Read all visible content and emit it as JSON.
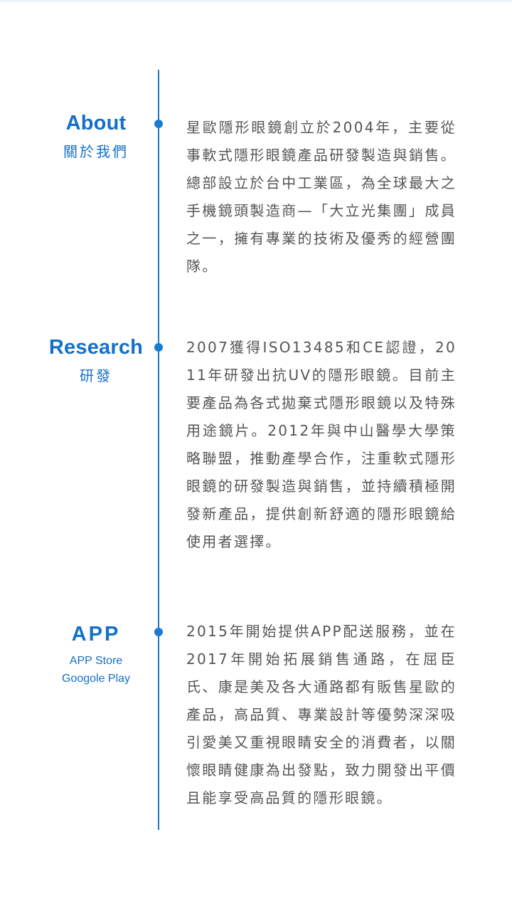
{
  "sections": [
    {
      "title": "About",
      "subtitle": "關於我們",
      "body": "星歐隱形眼鏡創立於2004年，主要從事軟式隱形眼鏡產品研發製造與銷售。總部設立於台中工業區，為全球最大之手機鏡頭製造商—「大立光集團」成員之一，擁有專業的技術及優秀的經營團隊。"
    },
    {
      "title": "Research",
      "subtitle": "研發",
      "body": "2007獲得ISO13485和CE認證，2011年研發出抗UV的隱形眼鏡。目前主要產品為各式拋棄式隱形眼鏡以及特殊用途鏡片。2012年與中山醫學大學策略聯盟，推動產學合作，注重軟式隱形眼鏡的研發製造與銷售，並持續積極開發新產品，提供創新舒適的隱形眼鏡給使用者選擇。"
    },
    {
      "title": "APP",
      "subtitle_line1": "APP Store",
      "subtitle_line2": "Googole Play",
      "body": "2015年開始提供APP配送服務，並在2017年開始拓展銷售通路，在屈臣氏、康是美及各大通路都有販售星歐的產品，高品質、專業設計等優勢深深吸引愛美又重視眼睛安全的消費者，以關懷眼睛健康為出發點，致力開發出平價且能享受高品質的隱形眼鏡。"
    }
  ],
  "colors": {
    "accent": "#1a7bd0",
    "body_text": "#555555"
  }
}
